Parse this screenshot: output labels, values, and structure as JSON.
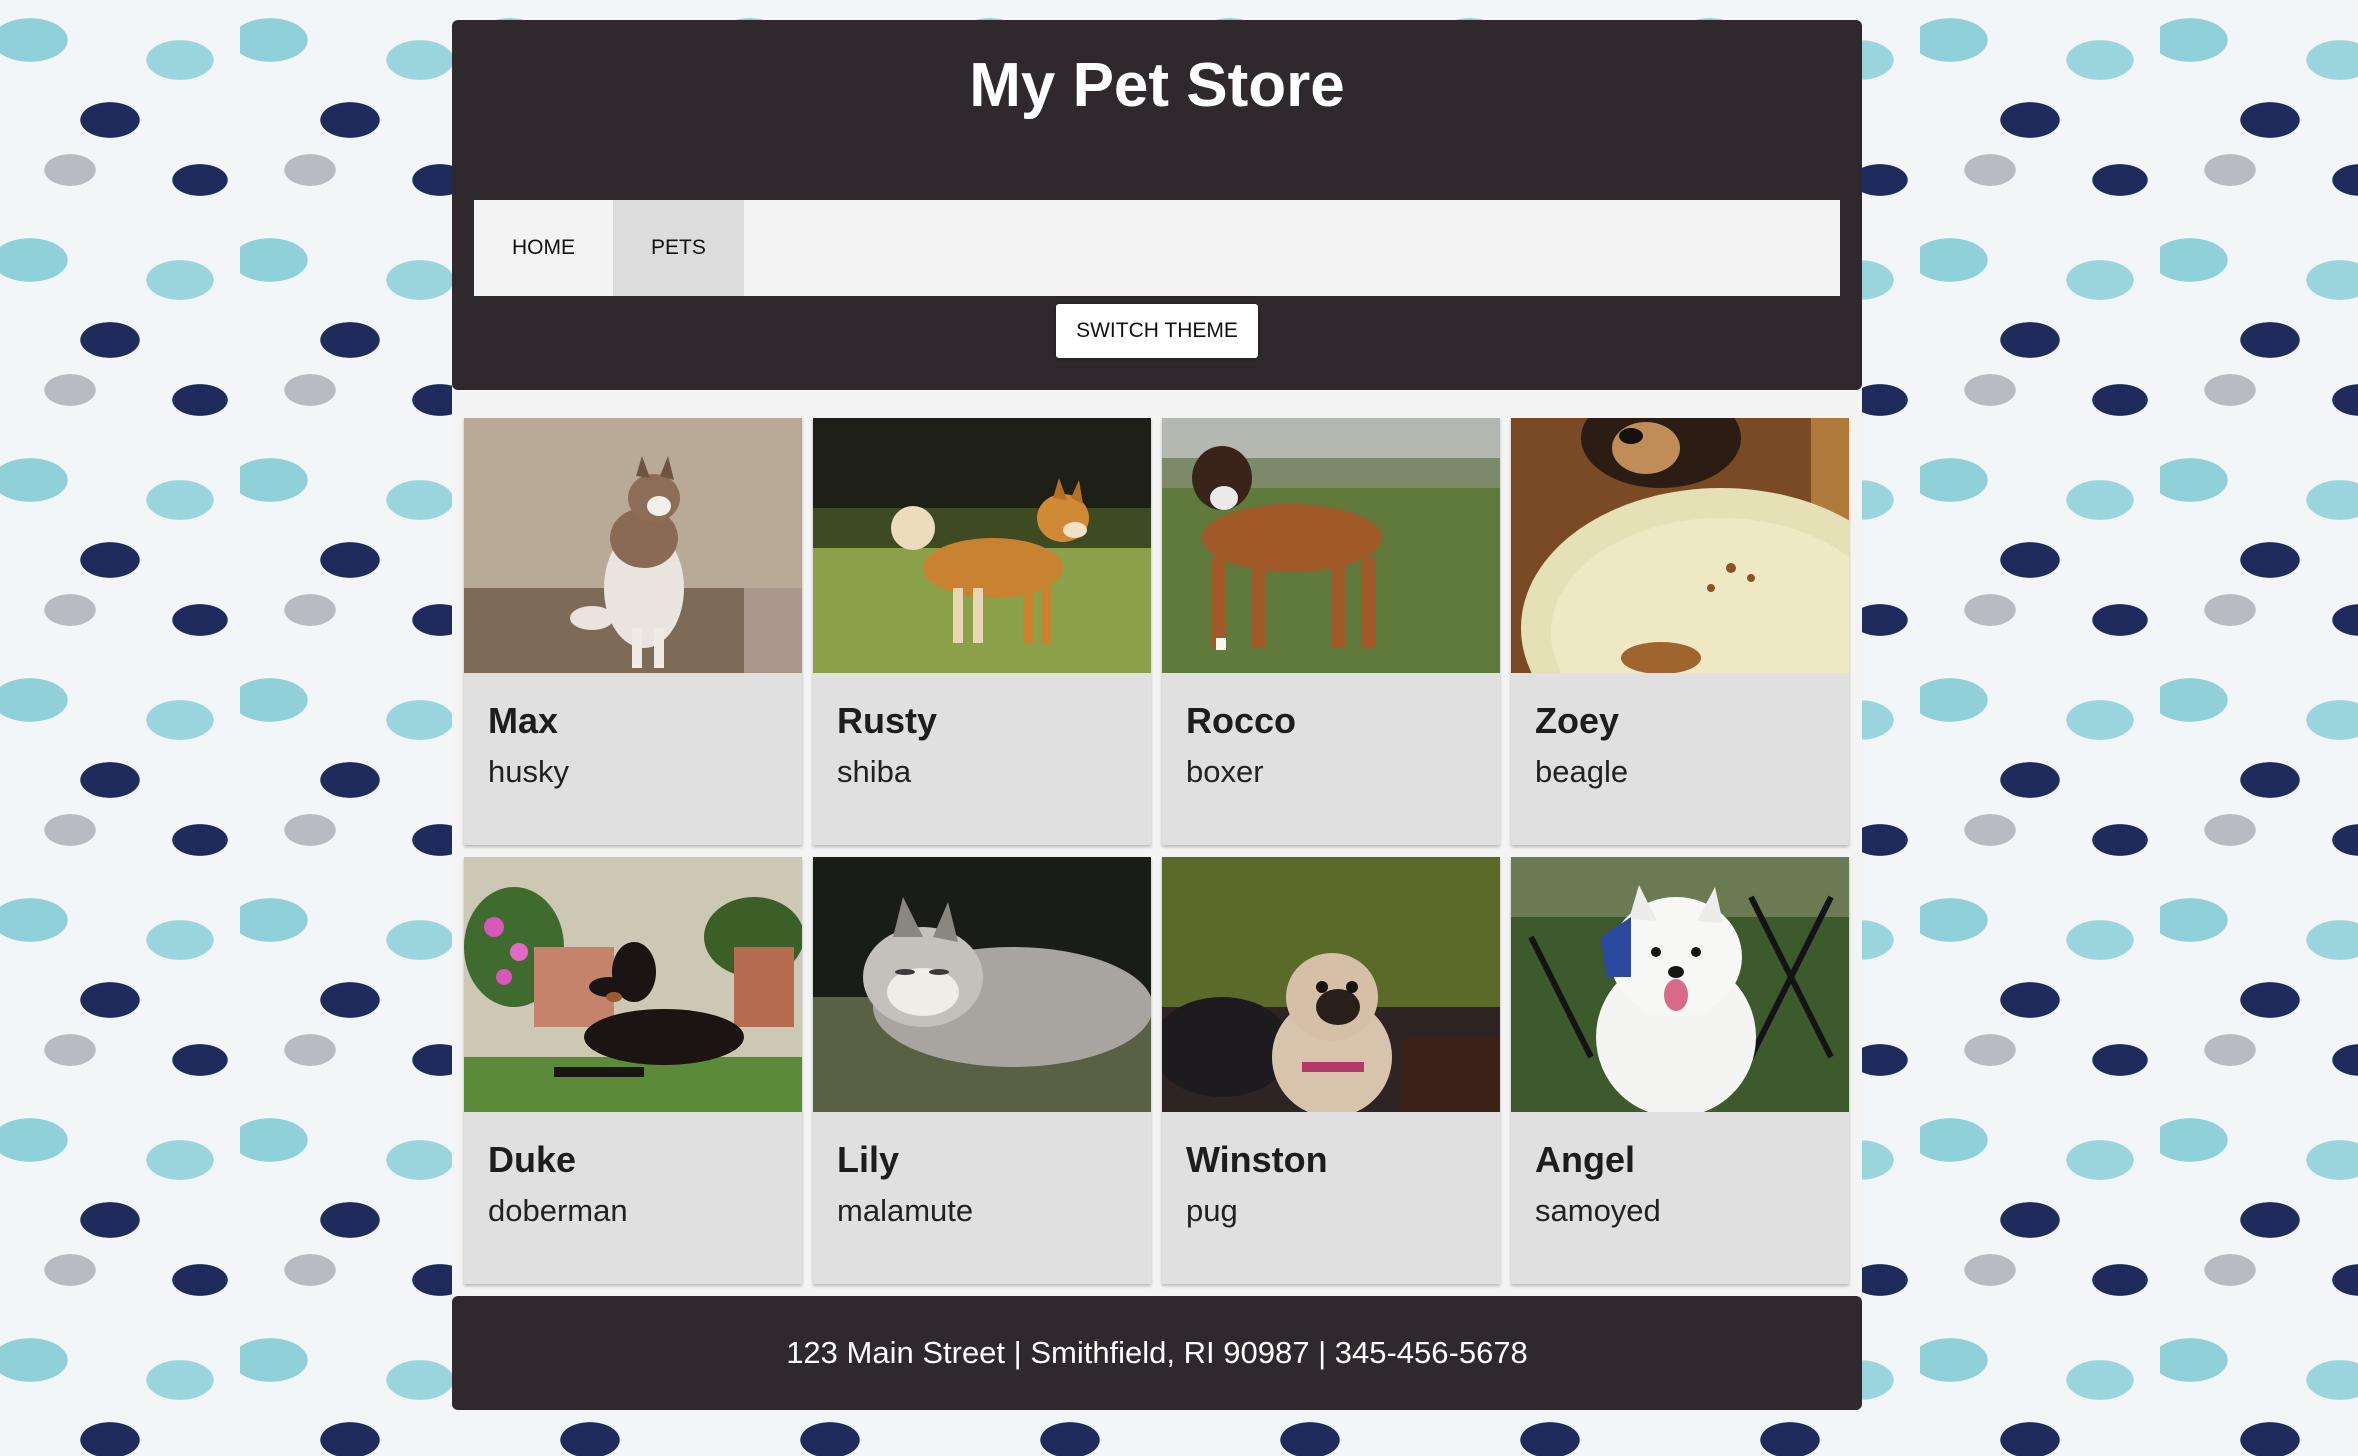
{
  "header": {
    "title": "My Pet Store",
    "nav": [
      {
        "label": "HOME",
        "active": false
      },
      {
        "label": "PETS",
        "active": true
      }
    ],
    "theme_button": "SWITCH THEME"
  },
  "pets": [
    {
      "name": "Max",
      "breed": "husky",
      "photo": "husky-photo"
    },
    {
      "name": "Rusty",
      "breed": "shiba",
      "photo": "shiba-photo"
    },
    {
      "name": "Rocco",
      "breed": "boxer",
      "photo": "boxer-photo"
    },
    {
      "name": "Zoey",
      "breed": "beagle",
      "photo": "beagle-photo"
    },
    {
      "name": "Duke",
      "breed": "doberman",
      "photo": "doberman-photo"
    },
    {
      "name": "Lily",
      "breed": "malamute",
      "photo": "malamute-photo"
    },
    {
      "name": "Winston",
      "breed": "pug",
      "photo": "pug-photo"
    },
    {
      "name": "Angel",
      "breed": "samoyed",
      "photo": "samoyed-photo"
    }
  ],
  "footer": {
    "text": "123 Main Street | Smithfield, RI 90987 | 345-456-5678"
  },
  "colors": {
    "header_bg": "#2f282c",
    "nav_bg": "#f4f4f4",
    "nav_active": "#dcdcdc",
    "card_bg": "#e0e0e0"
  }
}
